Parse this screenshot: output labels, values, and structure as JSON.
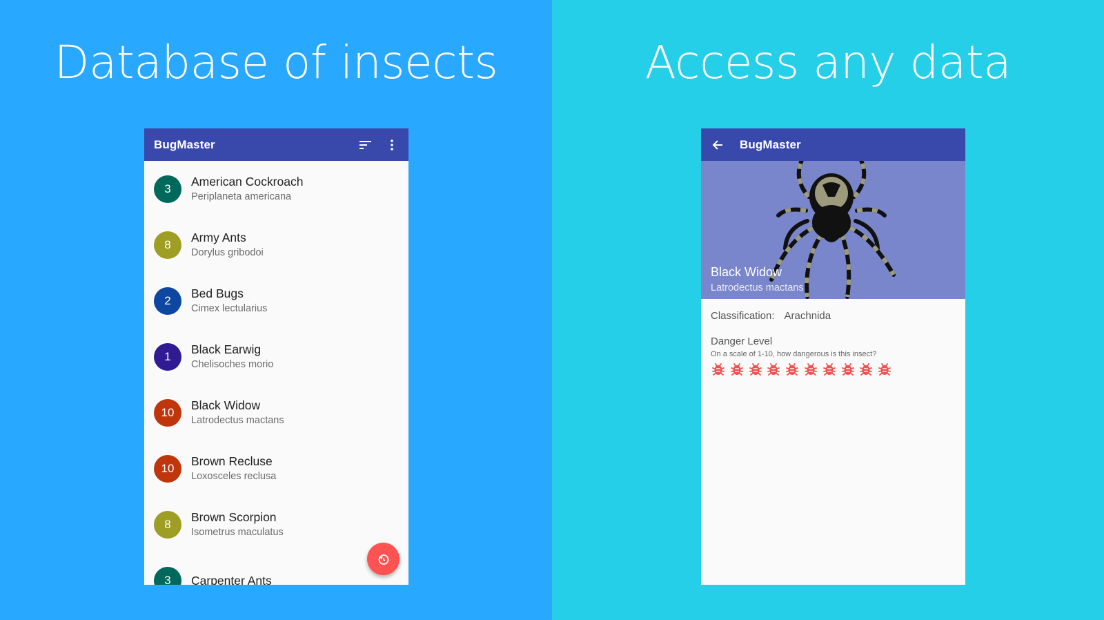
{
  "left": {
    "headline": "Database of insects",
    "app_title": "BugMaster",
    "items": [
      {
        "level": "3",
        "name": "American Cockroach",
        "sci": "Periplaneta americana",
        "color": "#00695c"
      },
      {
        "level": "8",
        "name": "Army Ants",
        "sci": "Dorylus gribodoi",
        "color": "#9e9d24"
      },
      {
        "level": "2",
        "name": "Bed Bugs",
        "sci": "Cimex lectularius",
        "color": "#0d47a1"
      },
      {
        "level": "1",
        "name": "Black Earwig",
        "sci": "Chelisoches morio",
        "color": "#311b92"
      },
      {
        "level": "10",
        "name": "Black Widow",
        "sci": "Latrodectus mactans",
        "color": "#bf360c"
      },
      {
        "level": "10",
        "name": "Brown Recluse",
        "sci": "Loxosceles reclusa",
        "color": "#bf360c"
      },
      {
        "level": "8",
        "name": "Brown Scorpion",
        "sci": "Isometrus maculatus",
        "color": "#9e9d24"
      },
      {
        "level": "3",
        "name": "Carpenter Ants",
        "sci": "",
        "color": "#00695c"
      }
    ]
  },
  "right": {
    "headline": "Access any data",
    "app_title": "BugMaster",
    "insect_name": "Black Widow",
    "insect_sci": "Latrodectus mactans",
    "classification_label": "Classification:",
    "classification_value": "Arachnida",
    "danger_title": "Danger Level",
    "danger_question": "On a scale of 1-10, how dangerous is this insect?",
    "danger_level": 10
  },
  "colors": {
    "left_bg": "#29a8ff",
    "right_bg": "#25cfe8",
    "appbar": "#3949ab",
    "hero": "#7986cb",
    "fab": "#ff5252",
    "bug": "#ef5350"
  },
  "icons": [
    "sort-icon",
    "more-vert-icon",
    "arrow-back-icon",
    "fab-timer-icon",
    "spider-image",
    "bug-icon"
  ]
}
